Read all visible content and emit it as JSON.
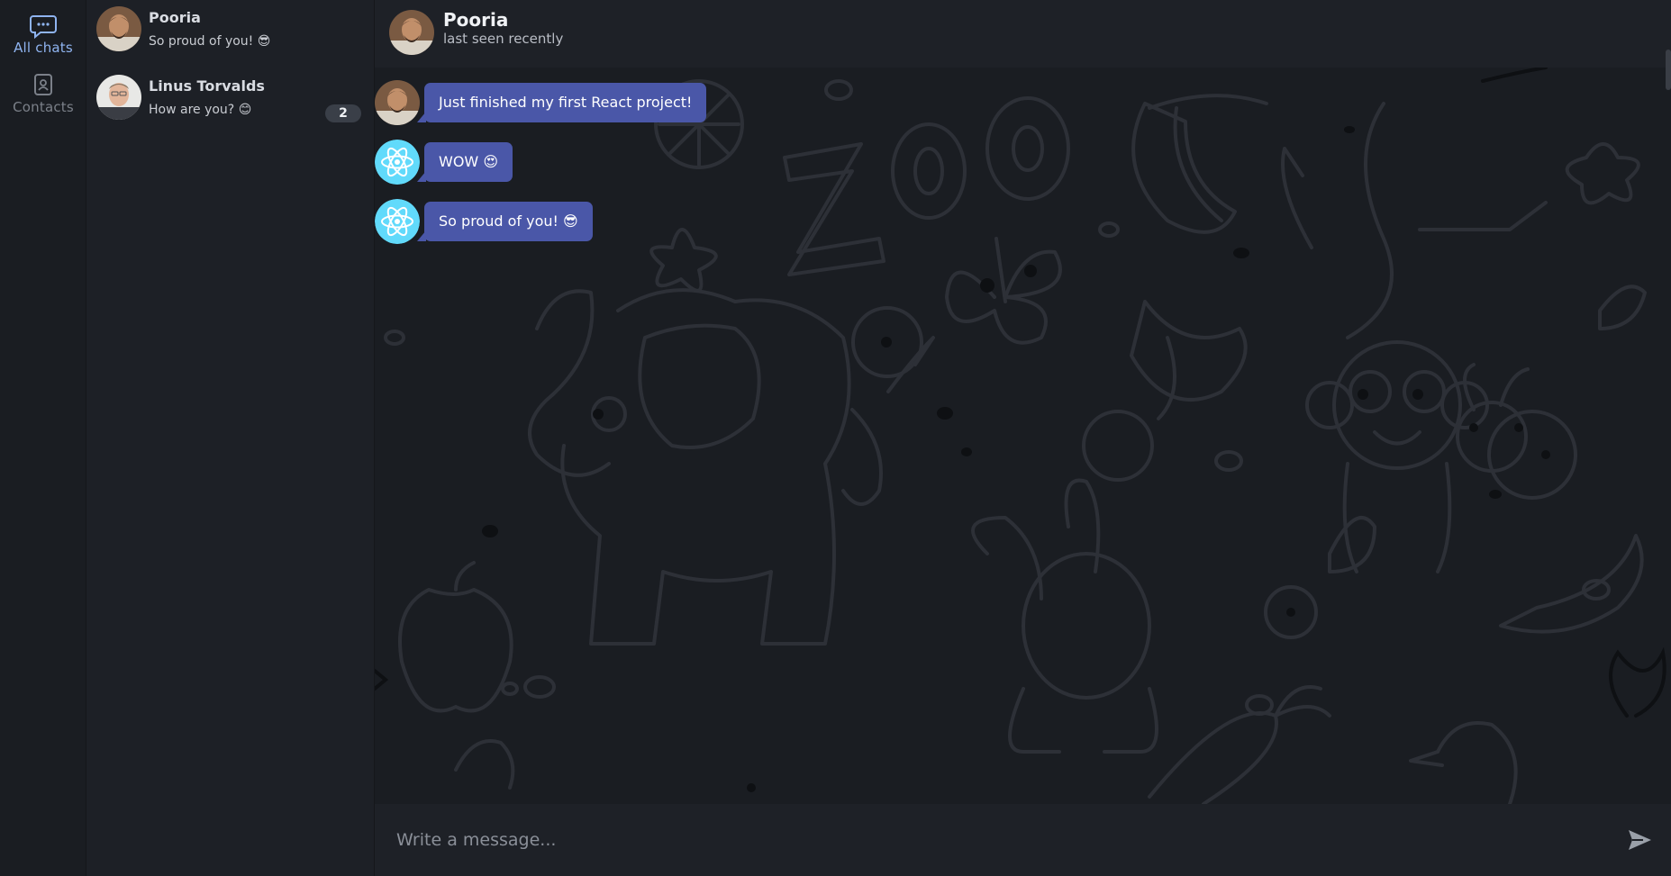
{
  "nav": {
    "items": [
      {
        "label": "All chats",
        "icon": "chat-bubble-icon",
        "active": true
      },
      {
        "label": "Contacts",
        "icon": "contacts-icon",
        "active": false
      }
    ]
  },
  "chat_list": [
    {
      "name": "Pooria",
      "last_message": "So proud of you! 😎",
      "unread": ""
    },
    {
      "name": "Linus Torvalds",
      "last_message": "How are you? 😊",
      "unread": "2"
    }
  ],
  "conversation": {
    "title": "Pooria",
    "status": "last seen recently",
    "messages": [
      {
        "text": "Just finished my first React project!",
        "sender": "pooria"
      },
      {
        "text": "WOW 😍",
        "sender": "me"
      },
      {
        "text": "So proud of you! 😎",
        "sender": "me"
      }
    ]
  },
  "composer": {
    "placeholder": "Write a message...",
    "send_icon": "send-icon"
  },
  "colors": {
    "accent": "#8fb4f0",
    "bubble": "#4a57a8",
    "react_cyan": "#61dafb"
  }
}
